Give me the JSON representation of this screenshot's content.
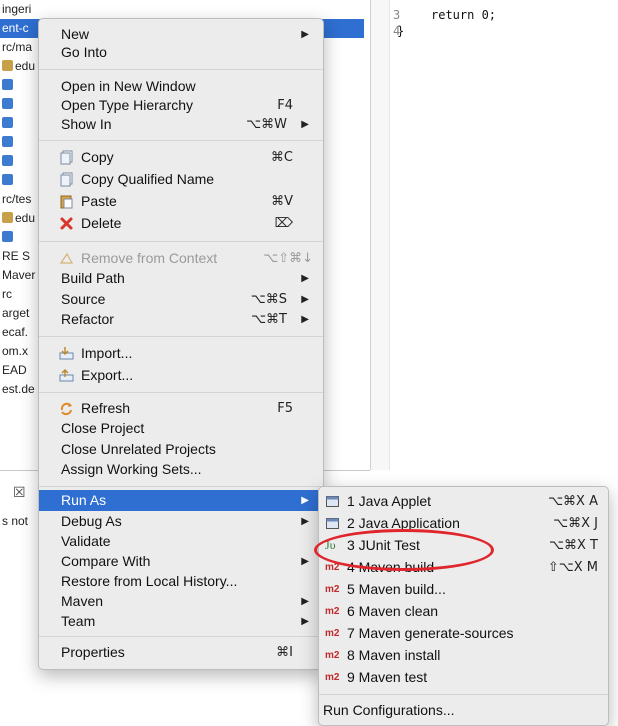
{
  "tree": {
    "rows": [
      {
        "text": "ingeri"
      },
      {
        "text": "ent-c",
        "selected": true
      },
      {
        "text": "rc/ma"
      },
      {
        "text": "edu",
        "icon": "pkg"
      },
      {
        "text": "",
        "icon": "java"
      },
      {
        "text": "",
        "icon": "java"
      },
      {
        "text": "",
        "icon": "java"
      },
      {
        "text": "",
        "icon": "java"
      },
      {
        "text": "",
        "icon": "java"
      },
      {
        "text": "",
        "icon": "java"
      },
      {
        "text": "rc/tes"
      },
      {
        "text": "edu",
        "icon": "pkg"
      },
      {
        "text": "",
        "icon": "java"
      },
      {
        "text": "RE S"
      },
      {
        "text": "Maver"
      },
      {
        "text": "rc"
      },
      {
        "text": "arget"
      },
      {
        "text": "ecaf."
      },
      {
        "text": "om.x"
      },
      {
        "text": "EAD"
      },
      {
        "text": "est.de"
      }
    ],
    "bottom_close": "☒",
    "bottom_text": "s not"
  },
  "editor": {
    "lines": [
      {
        "num": "3",
        "code": "return 0;"
      },
      {
        "num": "4",
        "code": "}"
      }
    ]
  },
  "main_menu": {
    "new": {
      "label": "New"
    },
    "go_into": {
      "label": "Go Into"
    },
    "open_new_window": {
      "label": "Open in New Window"
    },
    "open_type_hierarchy": {
      "label": "Open Type Hierarchy",
      "shortcut": "F4"
    },
    "show_in": {
      "label": "Show In",
      "shortcut": "⌥⌘W"
    },
    "copy": {
      "label": "Copy",
      "shortcut": "⌘C"
    },
    "copy_qualified": {
      "label": "Copy Qualified Name"
    },
    "paste": {
      "label": "Paste",
      "shortcut": "⌘V"
    },
    "delete": {
      "label": "Delete",
      "shortcut": "⌦"
    },
    "remove_context": {
      "label": "Remove from Context",
      "shortcut": "⌥⇧⌘↓"
    },
    "build_path": {
      "label": "Build Path"
    },
    "source": {
      "label": "Source",
      "shortcut": "⌥⌘S"
    },
    "refactor": {
      "label": "Refactor",
      "shortcut": "⌥⌘T"
    },
    "import": {
      "label": "Import..."
    },
    "export": {
      "label": "Export..."
    },
    "refresh": {
      "label": "Refresh",
      "shortcut": "F5"
    },
    "close_project": {
      "label": "Close Project"
    },
    "close_unrelated": {
      "label": "Close Unrelated Projects"
    },
    "assign_working_sets": {
      "label": "Assign Working Sets..."
    },
    "run_as": {
      "label": "Run As"
    },
    "debug_as": {
      "label": "Debug As"
    },
    "validate": {
      "label": "Validate"
    },
    "compare_with": {
      "label": "Compare With"
    },
    "restore_history": {
      "label": "Restore from Local History..."
    },
    "maven": {
      "label": "Maven"
    },
    "team": {
      "label": "Team"
    },
    "properties": {
      "label": "Properties",
      "shortcut": "⌘I"
    }
  },
  "run_as_menu": {
    "java_applet": {
      "label": "1 Java Applet",
      "shortcut": "⌥⌘X A"
    },
    "java_application": {
      "label": "2 Java Application",
      "shortcut": "⌥⌘X J"
    },
    "junit_test": {
      "label": "3 JUnit Test",
      "shortcut": "⌥⌘X T"
    },
    "maven_build": {
      "label": "4 Maven build",
      "shortcut": "⇧⌥X M"
    },
    "maven_build_dots": {
      "label": "5 Maven build..."
    },
    "maven_clean": {
      "label": "6 Maven clean"
    },
    "maven_generate_sources": {
      "label": "7 Maven generate-sources"
    },
    "maven_install": {
      "label": "8 Maven install"
    },
    "maven_test": {
      "label": "9 Maven test"
    },
    "run_configurations": {
      "label": "Run Configurations..."
    },
    "m2_badge": "m2",
    "ju_badge": "Jυ"
  },
  "arrow_glyph": "▶",
  "icons": {
    "copy": "copy-icon",
    "paste": "paste-icon",
    "delete": "delete-icon",
    "remove": "remove-context-icon",
    "import": "import-icon",
    "export": "export-icon",
    "refresh": "refresh-icon",
    "applet": "java-applet-icon",
    "application": "java-application-icon",
    "junit": "junit-icon",
    "maven": "maven-m2-icon"
  },
  "colors": {
    "highlight": "#2f6fd1",
    "annotation": "#e0262c",
    "delete_icon": "#d9352b"
  }
}
